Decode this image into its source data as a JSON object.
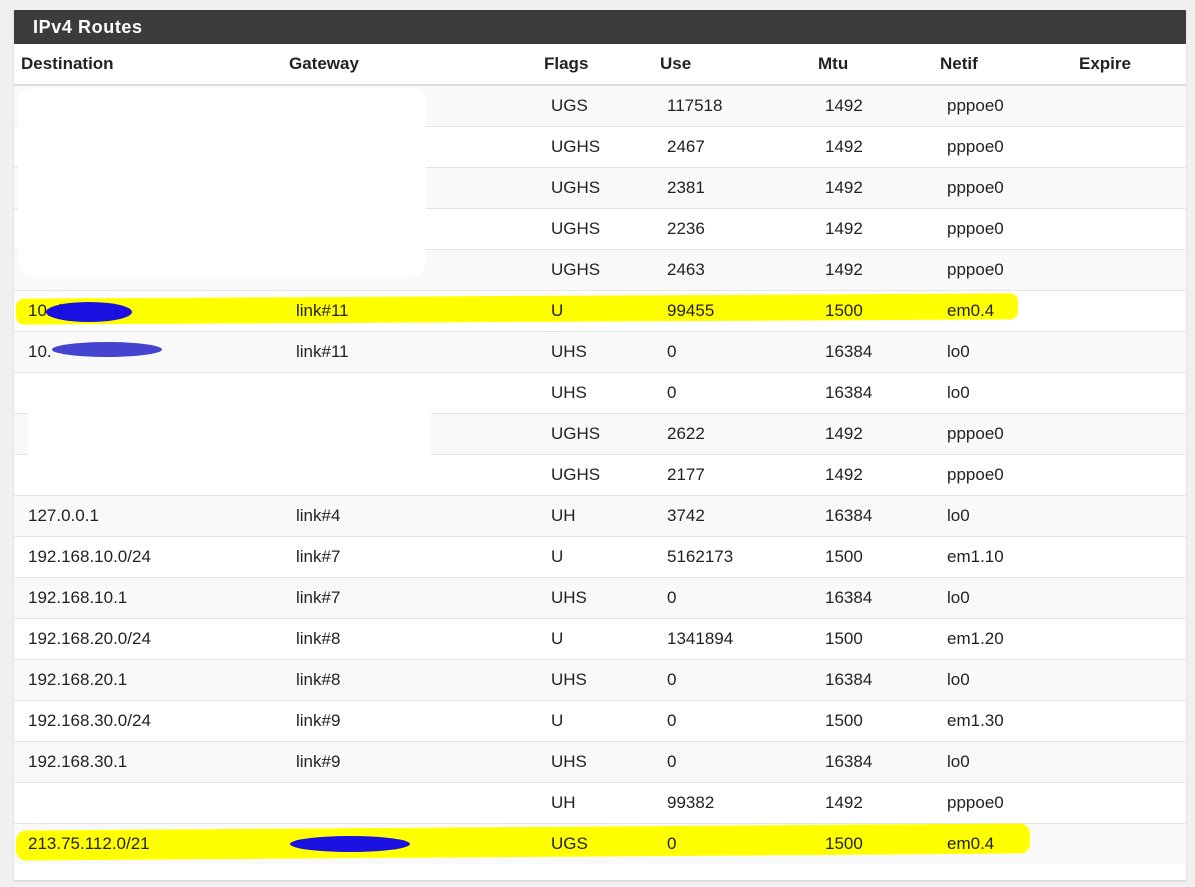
{
  "panel": {
    "title": "IPv4 Routes"
  },
  "columns": {
    "destination": "Destination",
    "gateway": "Gateway",
    "flags": "Flags",
    "use": "Use",
    "mtu": "Mtu",
    "netif": "Netif",
    "expire": "Expire"
  },
  "rows": [
    {
      "destination": "",
      "gateway": "",
      "flags": "UGS",
      "use": "117518",
      "mtu": "1492",
      "netif": "pppoe0",
      "expire": ""
    },
    {
      "destination": "",
      "gateway": "",
      "flags": "UGHS",
      "use": "2467",
      "mtu": "1492",
      "netif": "pppoe0",
      "expire": ""
    },
    {
      "destination": "",
      "gateway": "",
      "flags": "UGHS",
      "use": "2381",
      "mtu": "1492",
      "netif": "pppoe0",
      "expire": ""
    },
    {
      "destination": "",
      "gateway": "",
      "flags": "UGHS",
      "use": "2236",
      "mtu": "1492",
      "netif": "pppoe0",
      "expire": ""
    },
    {
      "destination": "",
      "gateway": "",
      "flags": "UGHS",
      "use": "2463",
      "mtu": "1492",
      "netif": "pppoe0",
      "expire": ""
    },
    {
      "destination": "10.          /22",
      "gateway": "link#11",
      "flags": "U",
      "use": "99455",
      "mtu": "1500",
      "netif": "em0.4",
      "expire": ""
    },
    {
      "destination": "10.",
      "gateway": "link#11",
      "flags": "UHS",
      "use": "0",
      "mtu": "16384",
      "netif": "lo0",
      "expire": ""
    },
    {
      "destination": "",
      "gateway": "",
      "flags": "UHS",
      "use": "0",
      "mtu": "16384",
      "netif": "lo0",
      "expire": ""
    },
    {
      "destination": "",
      "gateway": "",
      "flags": "UGHS",
      "use": "2622",
      "mtu": "1492",
      "netif": "pppoe0",
      "expire": ""
    },
    {
      "destination": "",
      "gateway": "",
      "flags": "UGHS",
      "use": "2177",
      "mtu": "1492",
      "netif": "pppoe0",
      "expire": ""
    },
    {
      "destination": "127.0.0.1",
      "gateway": "link#4",
      "flags": "UH",
      "use": "3742",
      "mtu": "16384",
      "netif": "lo0",
      "expire": ""
    },
    {
      "destination": "192.168.10.0/24",
      "gateway": "link#7",
      "flags": "U",
      "use": "5162173",
      "mtu": "1500",
      "netif": "em1.10",
      "expire": ""
    },
    {
      "destination": "192.168.10.1",
      "gateway": "link#7",
      "flags": "UHS",
      "use": "0",
      "mtu": "16384",
      "netif": "lo0",
      "expire": ""
    },
    {
      "destination": "192.168.20.0/24",
      "gateway": "link#8",
      "flags": "U",
      "use": "1341894",
      "mtu": "1500",
      "netif": "em1.20",
      "expire": ""
    },
    {
      "destination": "192.168.20.1",
      "gateway": "link#8",
      "flags": "UHS",
      "use": "0",
      "mtu": "16384",
      "netif": "lo0",
      "expire": ""
    },
    {
      "destination": "192.168.30.0/24",
      "gateway": "link#9",
      "flags": "U",
      "use": "0",
      "mtu": "1500",
      "netif": "em1.30",
      "expire": ""
    },
    {
      "destination": "192.168.30.1",
      "gateway": "link#9",
      "flags": "UHS",
      "use": "0",
      "mtu": "16384",
      "netif": "lo0",
      "expire": ""
    },
    {
      "destination": "",
      "gateway": "",
      "flags": "UH",
      "use": "99382",
      "mtu": "1492",
      "netif": "pppoe0",
      "expire": ""
    },
    {
      "destination": "213.75.112.0/21",
      "gateway": "",
      "flags": "UGS",
      "use": "0",
      "mtu": "1500",
      "netif": "em0.4",
      "expire": ""
    }
  ],
  "colors": {
    "header_bg": "#3c3c3c",
    "highlight": "#ffff00",
    "redaction_blue": "#1a10e0"
  }
}
